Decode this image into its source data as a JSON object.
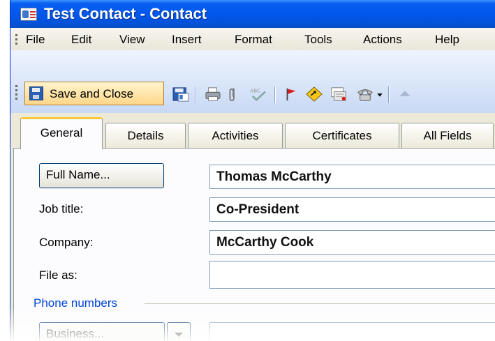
{
  "window": {
    "title": "Test Contact - Contact"
  },
  "menubar": {
    "items": [
      "File",
      "Edit",
      "View",
      "Insert",
      "Format",
      "Tools",
      "Actions",
      "Help"
    ]
  },
  "toolbar": {
    "save_close_label": "Save and Close"
  },
  "tabs": [
    "General",
    "Details",
    "Activities",
    "Certificates",
    "All Fields"
  ],
  "form": {
    "full_name_button": "Full Name...",
    "full_name": "Thomas McCarthy",
    "job_title_label": "Job title:",
    "job_title": "Co-President",
    "company_label": "Company:",
    "company": "McCarthy Cook",
    "file_as_label": "File as:",
    "file_as": "",
    "phone_section": "Phone numbers",
    "phone_type": "Business...",
    "phone_value": ""
  },
  "colors": {
    "titlebar": "#0058ee",
    "active_tab_accent": "#ffc83c",
    "section_heading": "#0046d5",
    "save_button_hover": "#ffd68a"
  }
}
